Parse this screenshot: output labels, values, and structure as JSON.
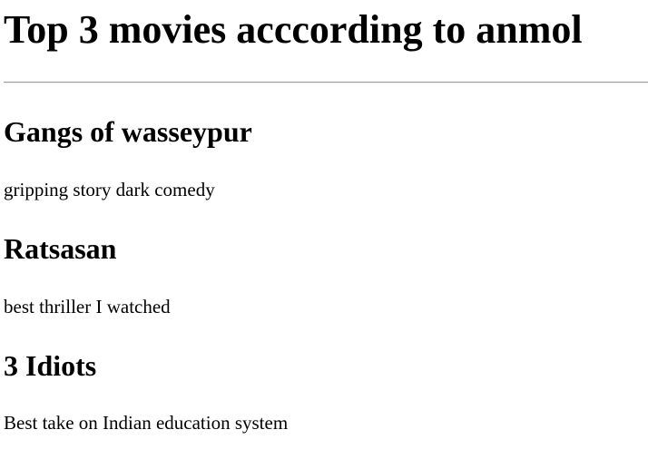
{
  "page": {
    "title": "Top 3 movies acccording to anmol"
  },
  "movies": [
    {
      "title": "Gangs of wasseypur",
      "description": "gripping story dark comedy"
    },
    {
      "title": "Ratsasan",
      "description": "best thriller I watched"
    },
    {
      "title": "3 Idiots",
      "description": "Best take on Indian education system"
    }
  ]
}
